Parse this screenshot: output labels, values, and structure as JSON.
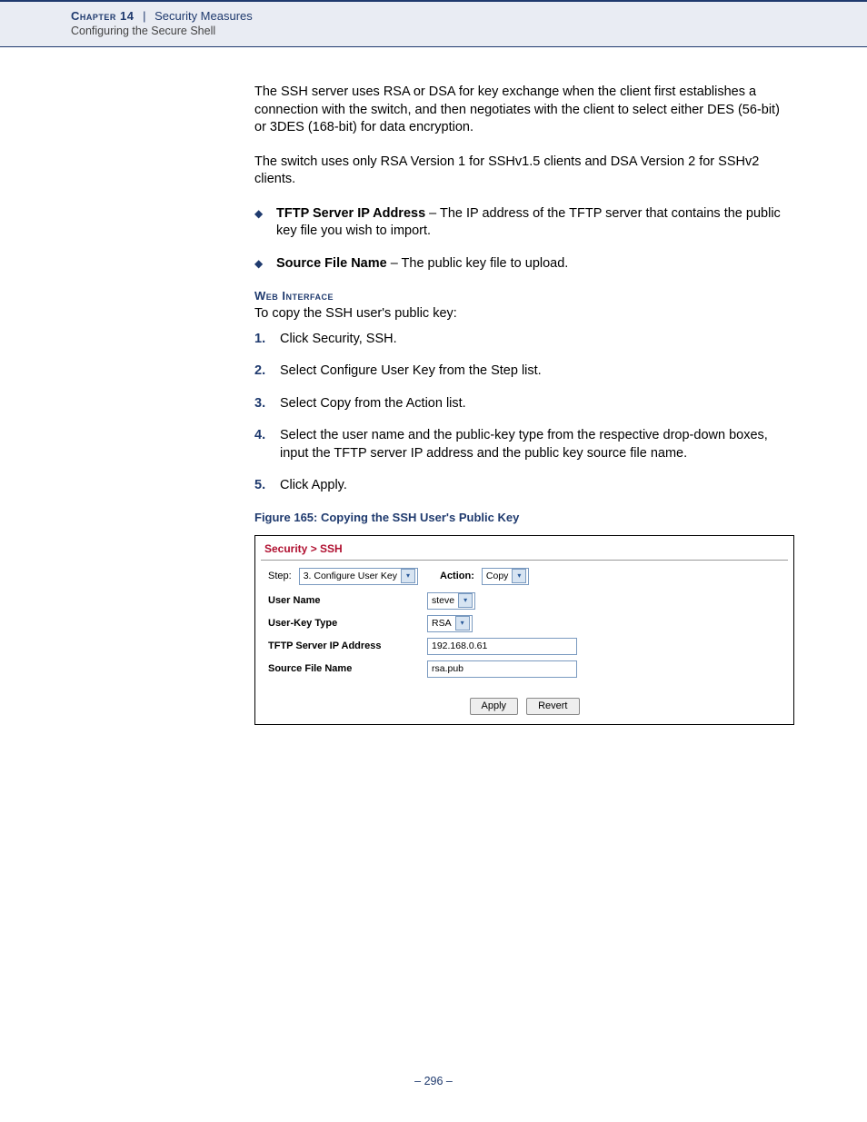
{
  "header": {
    "chapter": "Chapter 14",
    "separator": "|",
    "title": "Security Measures",
    "subtitle": "Configuring the Secure Shell"
  },
  "body": {
    "para1": "The SSH server uses RSA or DSA for key exchange when the client first establishes a connection with the switch, and then negotiates with the client to select either DES (56-bit) or 3DES (168-bit) for data encryption.",
    "para2": "The switch uses only RSA Version 1 for SSHv1.5 clients and DSA Version 2 for SSHv2 clients.",
    "bullets": [
      {
        "term": "TFTP Server IP Address",
        "desc": " – The IP address of the TFTP server that contains the public key file you wish to import."
      },
      {
        "term": "Source File Name",
        "desc": " – The public key file to upload."
      }
    ],
    "subhead": "Web Interface",
    "intro": "To copy the SSH user's public key:",
    "steps": [
      "Click Security, SSH.",
      "Select Configure User Key from the Step list.",
      "Select Copy from the Action list.",
      "Select the user name and the public-key type from the respective drop-down boxes, input the TFTP server IP address and the public key source file name.",
      "Click Apply."
    ],
    "figure_caption": "Figure 165:  Copying the SSH User's Public Key"
  },
  "screenshot": {
    "breadcrumb": "Security > SSH",
    "step_label": "Step:",
    "step_value": "3. Configure User Key",
    "action_label": "Action:",
    "action_value": "Copy",
    "fields": {
      "username_label": "User Name",
      "username_value": "steve",
      "keytype_label": "User-Key Type",
      "keytype_value": "RSA",
      "tftp_label": "TFTP Server IP Address",
      "tftp_value": "192.168.0.61",
      "source_label": "Source File Name",
      "source_value": "rsa.pub"
    },
    "buttons": {
      "apply": "Apply",
      "revert": "Revert"
    }
  },
  "page_number": "–  296  –"
}
